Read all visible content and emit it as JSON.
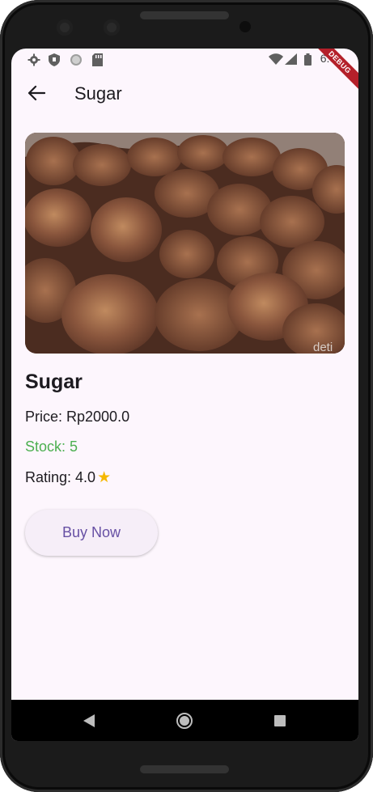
{
  "status_bar": {
    "time": "6:09"
  },
  "debug_banner": "DEBUG",
  "app_bar": {
    "title": "Sugar"
  },
  "product": {
    "name": "Sugar",
    "price_text": "Price: Rp2000.0",
    "stock_text": "Stock: 5",
    "rating_text": "Rating: 4.0",
    "image_watermark": "deti"
  },
  "actions": {
    "buy_label": "Buy Now"
  },
  "colors": {
    "stock": "#4caf50",
    "star": "#f5b800",
    "button_text": "#6750a4",
    "background": "#fdf6fd"
  },
  "icons": [
    "settings-icon",
    "shield-icon",
    "circle-icon",
    "sdcard-icon",
    "wifi-icon",
    "signal-icon",
    "battery-icon",
    "arrow-back-icon",
    "star-icon",
    "nav-back-icon",
    "nav-home-icon",
    "nav-recents-icon"
  ]
}
